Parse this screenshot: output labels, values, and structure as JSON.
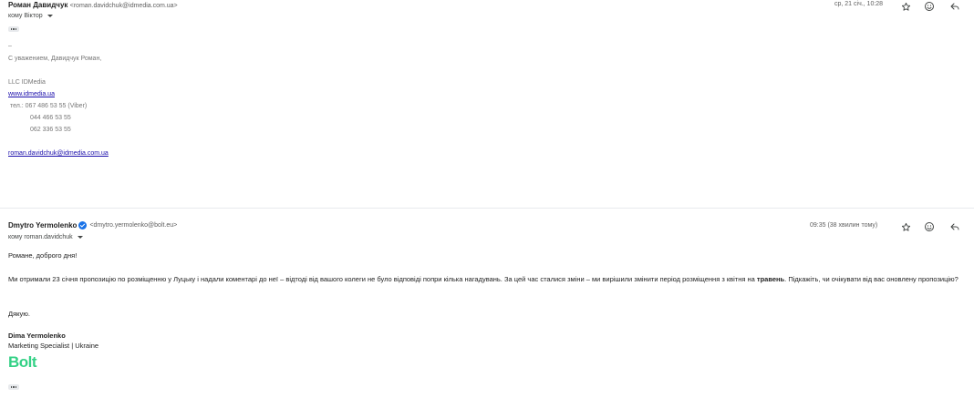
{
  "message1": {
    "sender_name": "Роман Давидчук",
    "sender_email": "<roman.davidchuk@idmedia.com.ua>",
    "to_label": "кому Віктор",
    "date": "ср, 21 січ., 10:28",
    "dash": "–",
    "signature": {
      "regards": "С уважением, Давидчук Роман,",
      "company": "LLC IDMedia",
      "website": "www.idmedia.ua",
      "phone1": " тел.: 067 486 53 55 (Viber)",
      "phone2": "044 466 53 55",
      "phone3": "062 336 53 55",
      "email": "roman.davidchuk@idmedia.com.ua"
    }
  },
  "message2": {
    "sender_name": "Dmytro Yermolenko",
    "sender_email": "<dmytro.yermolenko@bolt.eu>",
    "to_label": "кому roman.davidchuk",
    "date": "09:35 (38 хвилин тому)",
    "greeting": "Романе, доброго дня!",
    "paragraph_part1": "Ми отримали 23 січня пропозицію по розміщенню у Луцьку і надали коментарі до неї – відтоді від вашого колеги не було відповіді попри кілька нагадувань. За цей час сталися зміни – ми вирішили змінити період розміщення з квітня на ",
    "paragraph_bold": "травень",
    "paragraph_part2": ". Підкажіть, чи очікувати від вас оновлену пропозицію?",
    "thanks": "Дякую.",
    "signature": {
      "name": "Dima Yermolenko",
      "title": "Marketing Specialist | Ukraine",
      "logo_text": "Bolt"
    }
  },
  "colors": {
    "bolt_green": "#34d186",
    "link": "#1a0dab",
    "verified": "#1a73e8"
  },
  "icons": [
    "star-icon",
    "emoji-icon",
    "reply-icon",
    "more-dots-icon",
    "verified-icon",
    "chevron-down-icon"
  ]
}
